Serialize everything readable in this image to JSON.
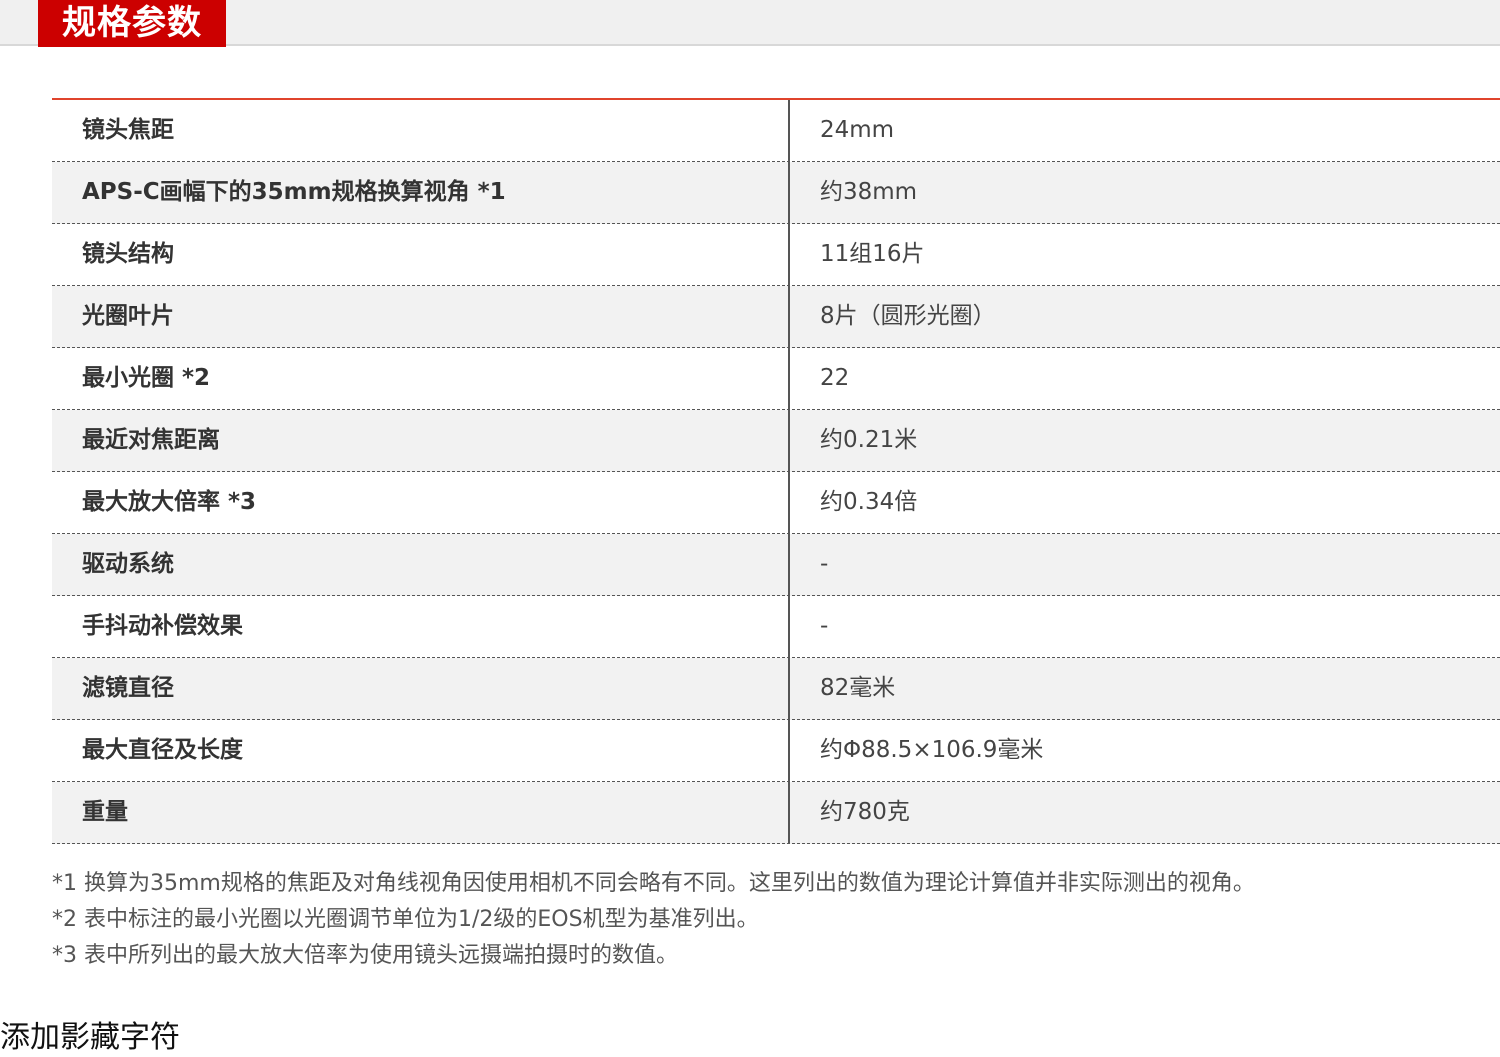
{
  "header": {
    "title": "规格参数"
  },
  "specs": [
    {
      "label": "镜头焦距",
      "value": "24mm"
    },
    {
      "label": "APS-C画幅下的35mm规格换算视角 *1",
      "value": "约38mm"
    },
    {
      "label": "镜头结构",
      "value": "11组16片"
    },
    {
      "label": "光圈叶片",
      "value": "8片（圆形光圈）"
    },
    {
      "label": "最小光圈 *2",
      "value": "22"
    },
    {
      "label": "最近对焦距离",
      "value": "约0.21米"
    },
    {
      "label": "最大放大倍率 *3",
      "value": "约0.34倍"
    },
    {
      "label": "驱动系统",
      "value": "-"
    },
    {
      "label": "手抖动补偿效果",
      "value": "-"
    },
    {
      "label": "滤镜直径",
      "value": "82毫米"
    },
    {
      "label": "最大直径及长度",
      "value": "约Φ88.5×106.9毫米"
    },
    {
      "label": "重量",
      "value": "约780克"
    }
  ],
  "notes": [
    "*1 换算为35mm规格的焦距及对角线视角因使用相机不同会略有不同。这里列出的数值为理论计算值并非实际测出的视角。",
    "*2 表中标注的最小光圈以光圈调节单位为1/2级的EOS机型为基准列出。",
    "*3 表中所列出的最大放大倍率为使用镜头远摄端拍摄时的数值。"
  ],
  "footer": {
    "text": "添加影藏字符"
  },
  "colors": {
    "accent": "#cc0000",
    "table_top_border": "#e0442c"
  }
}
